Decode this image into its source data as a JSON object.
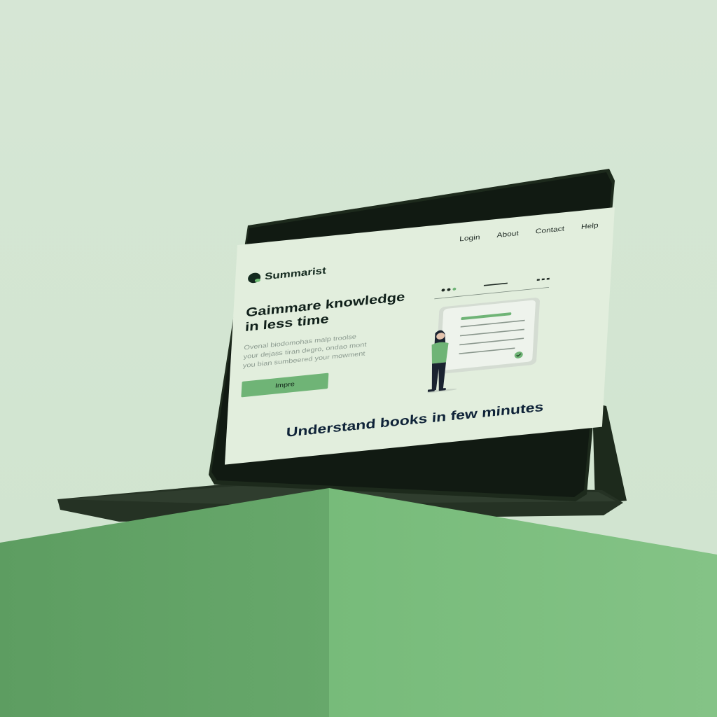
{
  "brand": {
    "name": "Summarist"
  },
  "nav": {
    "login": "Login",
    "about": "About",
    "contact": "Contact",
    "help": "Help"
  },
  "hero": {
    "headline_line1": "Gaimmare knowledge",
    "headline_line2": "in less time",
    "sub_line1": "Ovenal biodomohas malp troolse",
    "sub_line2": "your dejass tiran degro, ondao mont",
    "sub_line3": "you bian sumbeered your mowment",
    "cta_label": "Impre"
  },
  "tagline": "Understand books in few minutes",
  "colors": {
    "screen_bg": "#e2eedd",
    "accent_green": "#6fb476",
    "dark_text": "#10201a",
    "pedestal_green": "#74b877",
    "tablet_frame": "#1d2a1c"
  },
  "icons": [
    "logo-dot-icon",
    "woman-figure-illustration",
    "check-circle-icon"
  ]
}
